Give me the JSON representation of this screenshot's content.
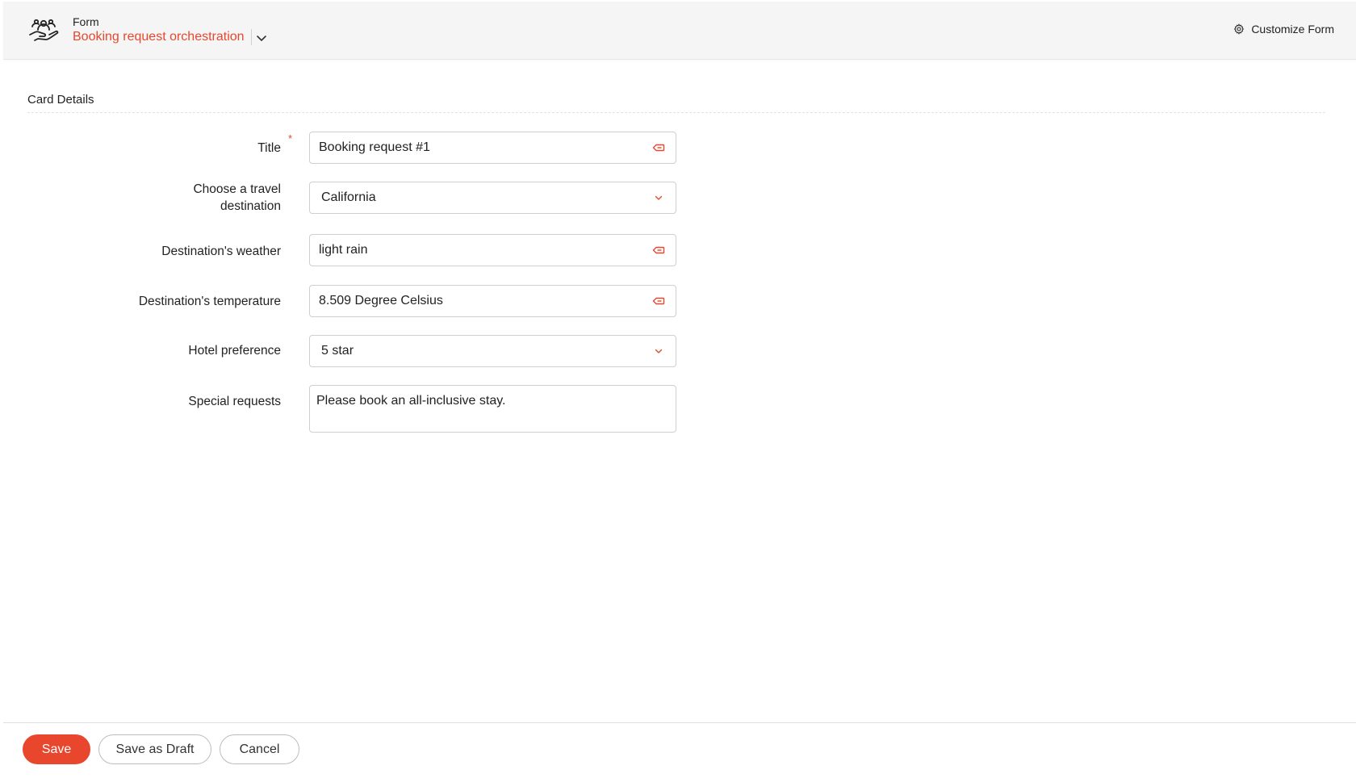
{
  "header": {
    "kicker": "Form",
    "title": "Booking request orchestration",
    "customize_label": "Customize Form",
    "accent_color": "#e8472e"
  },
  "section": {
    "title": "Card Details"
  },
  "fields": {
    "title": {
      "label": "Title",
      "required_mark": "*",
      "value": "Booking request #1",
      "icon": "tag-icon"
    },
    "destination": {
      "label_line1": "Choose a travel",
      "label_line2": "destination",
      "value": "California",
      "icon": "chevron-down-icon"
    },
    "weather": {
      "label": "Destination's weather",
      "value": "light rain",
      "icon": "tag-icon"
    },
    "temperature": {
      "label": "Destination's temperature",
      "value": "8.509 Degree Celsius",
      "icon": "tag-icon"
    },
    "hotel": {
      "label": "Hotel preference",
      "value": "5 star",
      "icon": "chevron-down-icon"
    },
    "special": {
      "label": "Special requests",
      "value": "Please book an all-inclusive stay."
    }
  },
  "footer": {
    "save_label": "Save",
    "draft_label": "Save as Draft",
    "cancel_label": "Cancel"
  }
}
